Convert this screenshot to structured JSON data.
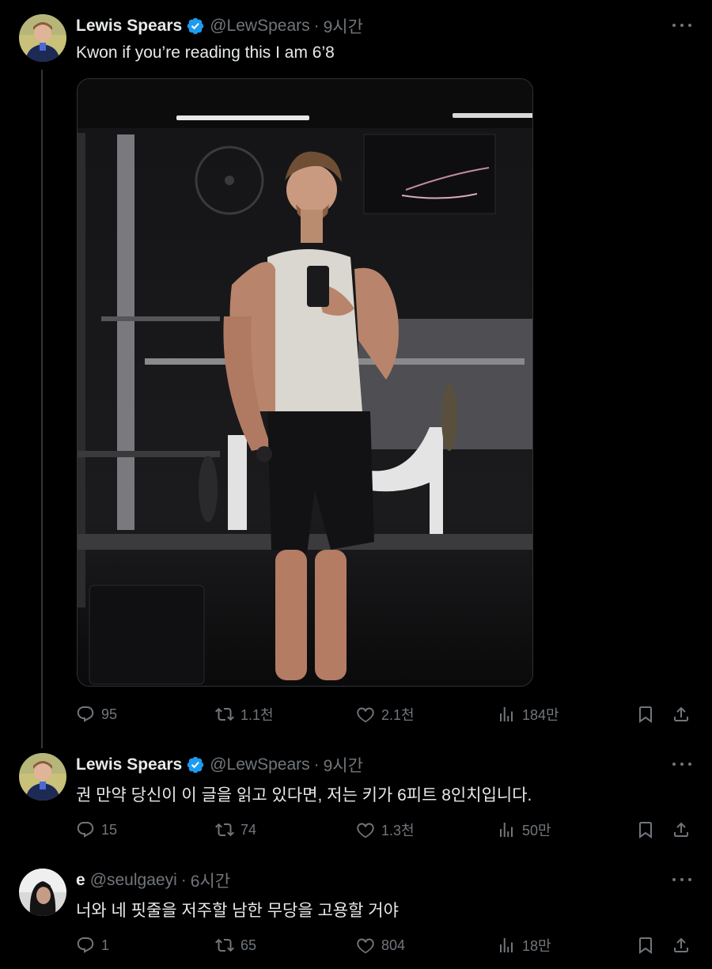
{
  "colors": {
    "background": "#000000",
    "text": "#e7e9ea",
    "muted": "#71767b",
    "verified": "#1d9bf0",
    "thread_line": "#333639"
  },
  "tweets": [
    {
      "author": {
        "name": "Lewis Spears",
        "handle": "@LewSpears",
        "verified": true
      },
      "time": "9시간",
      "text": "Kwon if you’re reading this I am 6’8",
      "media": "gym-mirror-selfie-photo",
      "stats": {
        "replies": "95",
        "retweets": "1.1천",
        "likes": "2.1천",
        "views": "184만"
      }
    },
    {
      "author": {
        "name": "Lewis Spears",
        "handle": "@LewSpears",
        "verified": true
      },
      "time": "9시간",
      "text": "권 만약 당신이 이 글을 읽고 있다면, 저는 키가 6피트 8인치입니다.",
      "stats": {
        "replies": "15",
        "retweets": "74",
        "likes": "1.3천",
        "views": "50만"
      }
    },
    {
      "author": {
        "name": "e",
        "handle": "@seulgaeyi",
        "verified": false
      },
      "time": "6시간",
      "text": "너와 네 핏줄을 저주할 남한 무당을 고용할 거야",
      "stats": {
        "replies": "1",
        "retweets": "65",
        "likes": "804",
        "views": "18만"
      }
    }
  ],
  "icons": {
    "reply": "reply-icon",
    "retweet": "retweet-icon",
    "like": "heart-icon",
    "views": "views-icon",
    "bookmark": "bookmark-icon",
    "share": "share-icon",
    "more": "more-icon",
    "verified": "verified-badge-icon"
  },
  "separator": "·"
}
